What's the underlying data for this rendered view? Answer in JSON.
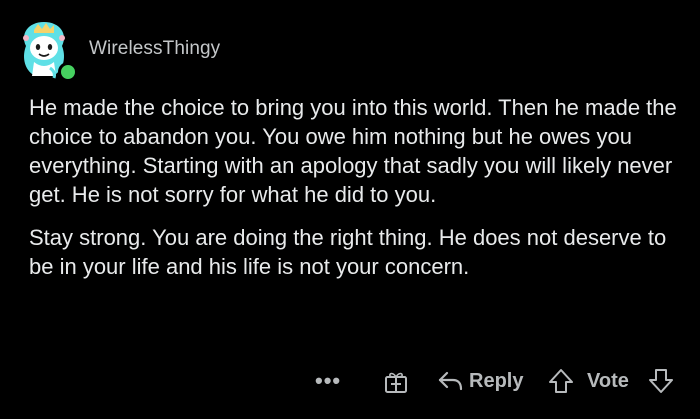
{
  "comment": {
    "username": "WirelessThingy",
    "paragraphs": [
      "He made the choice to bring you into this world. Then he made the choice to abandon you. You owe him nothing but he owes you everything. Starting with an apology that sadly you will likely never get. He is not sorry for what he did to you.",
      "Stay strong. You are doing the right thing. He does not deserve to be in your life and his life is not your concern."
    ],
    "online_status_color": "#46d160"
  },
  "actions": {
    "more_label": "•••",
    "award_icon": "gift-icon",
    "reply_label": "Reply",
    "reply_icon": "reply-arrow-icon",
    "vote_label": "Vote",
    "upvote_icon": "arrow-up-icon",
    "downvote_icon": "arrow-down-icon"
  },
  "colors": {
    "background": "#000000",
    "text": "#e8eaeb",
    "muted": "#b7babc"
  }
}
